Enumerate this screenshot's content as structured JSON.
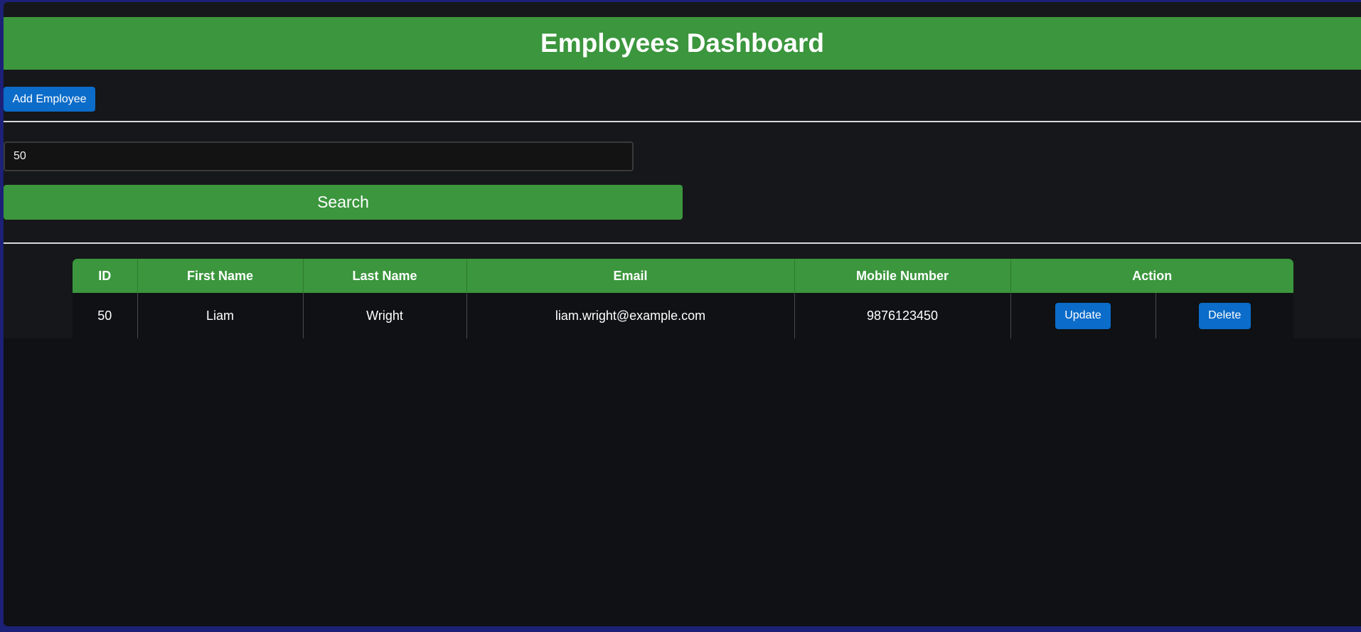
{
  "header": {
    "title": "Employees Dashboard"
  },
  "toolbar": {
    "add_employee_label": "Add Employee"
  },
  "search": {
    "value": "50",
    "button_label": "Search"
  },
  "table": {
    "columns": [
      "ID",
      "First Name",
      "Last Name",
      "Email",
      "Mobile Number",
      "Action"
    ],
    "rows": [
      {
        "id": "50",
        "first_name": "Liam",
        "last_name": "Wright",
        "email": "liam.wright@example.com",
        "mobile": "9876123450",
        "update_label": "Update",
        "delete_label": "Delete"
      }
    ]
  },
  "colors": {
    "accent_green": "#3b963d",
    "button_blue": "#0b6cc9",
    "background": "#16171a"
  }
}
